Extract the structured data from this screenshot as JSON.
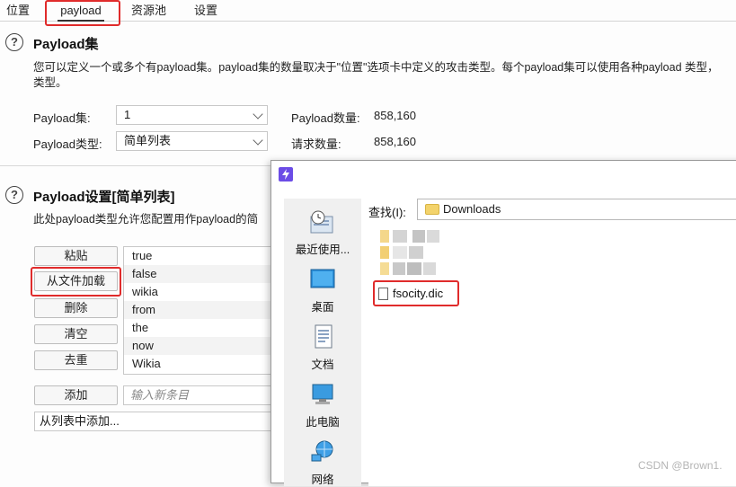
{
  "tabs": [
    {
      "label": "位置"
    },
    {
      "label": "payload"
    },
    {
      "label": "资源池"
    },
    {
      "label": "设置"
    }
  ],
  "payload_sets": {
    "title": "Payload集",
    "description": "您可以定义一个或多个有payload集。payload集的数量取决于\"位置\"选项卡中定义的攻击类型。每个payload集可以使用各种payload 类型，",
    "description_line2": "类型。",
    "set_label": "Payload集:",
    "set_value": "1",
    "count_label": "Payload数量:",
    "count_value": "858,160",
    "type_label": "Payload类型:",
    "type_value": "简单列表",
    "requests_label": "请求数量:",
    "requests_value": "858,160"
  },
  "payload_settings": {
    "title": "Payload设置[简单列表]",
    "description": "此处payload类型允许您配置用作payload的简",
    "buttons": {
      "paste": "粘贴",
      "load": "从文件加载",
      "remove": "删除",
      "clear": "清空",
      "dedupe": "去重",
      "add": "添加",
      "add_from_list": "从列表中添加..."
    },
    "list_items": [
      "true",
      "false",
      "wikia",
      "from",
      "the",
      "now",
      "Wikia"
    ],
    "new_item_placeholder": "输入新条目"
  },
  "file_dialog": {
    "lookin_label": "查找(I):",
    "lookin_value": "Downloads",
    "places": [
      {
        "label": "最近使用...",
        "icon": "recent-places-icon"
      },
      {
        "label": "桌面",
        "icon": "desktop-icon"
      },
      {
        "label": "文档",
        "icon": "documents-icon"
      },
      {
        "label": "此电脑",
        "icon": "this-pc-icon"
      },
      {
        "label": "网络",
        "icon": "network-icon"
      }
    ],
    "selected_file": "fsocity.dic"
  },
  "watermark": "CSDN @Brown1.",
  "colors": {
    "highlight_red": "#e02b2b",
    "dialog_accent": "#6b4ce6"
  }
}
